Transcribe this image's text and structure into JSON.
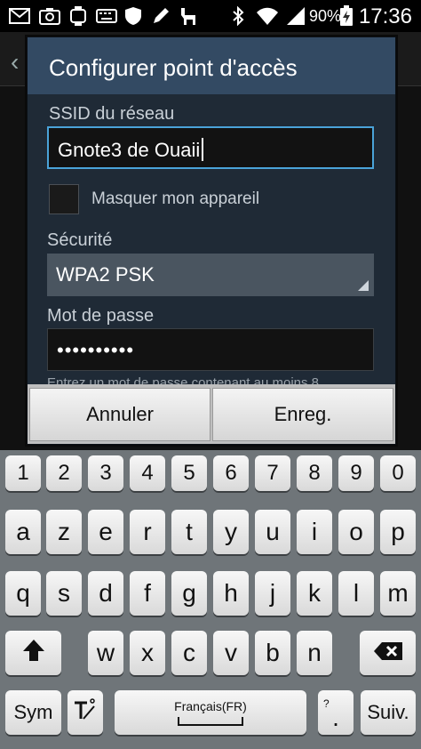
{
  "status_bar": {
    "battery": "90%",
    "time": "17:36",
    "icons": [
      "mail-icon",
      "camera-icon",
      "watch-icon",
      "keyboard-icon",
      "shield-icon",
      "pen-icon",
      "llama-icon",
      "bluetooth-icon",
      "wifi-icon",
      "signal-icon",
      "battery-icon"
    ]
  },
  "dialog": {
    "title": "Configurer point d'accès",
    "ssid_label": "SSID du réseau",
    "ssid_value": "Gnote3 de Ouaii",
    "hide_label": "Masquer mon appareil",
    "hide_checked": false,
    "security_label": "Sécurité",
    "security_value": "WPA2 PSK",
    "password_label": "Mot de passe",
    "password_value": "••••••••••",
    "hint": "Entrez un mot de passe contenant au moins 8",
    "cancel_label": "Annuler",
    "save_label": "Enreg."
  },
  "keyboard": {
    "row_numbers": [
      "1",
      "2",
      "3",
      "4",
      "5",
      "6",
      "7",
      "8",
      "9",
      "0"
    ],
    "row1": [
      "a",
      "z",
      "e",
      "r",
      "t",
      "y",
      "u",
      "i",
      "o",
      "p"
    ],
    "row2": [
      "q",
      "s",
      "d",
      "f",
      "g",
      "h",
      "j",
      "k",
      "l",
      "m"
    ],
    "row3": [
      "w",
      "x",
      "c",
      "v",
      "b",
      "n"
    ],
    "sym_label": "Sym",
    "language_label": "Français(FR)",
    "next_label": "Suiv.",
    "punct_label": ".",
    "punct_hint": "?"
  }
}
